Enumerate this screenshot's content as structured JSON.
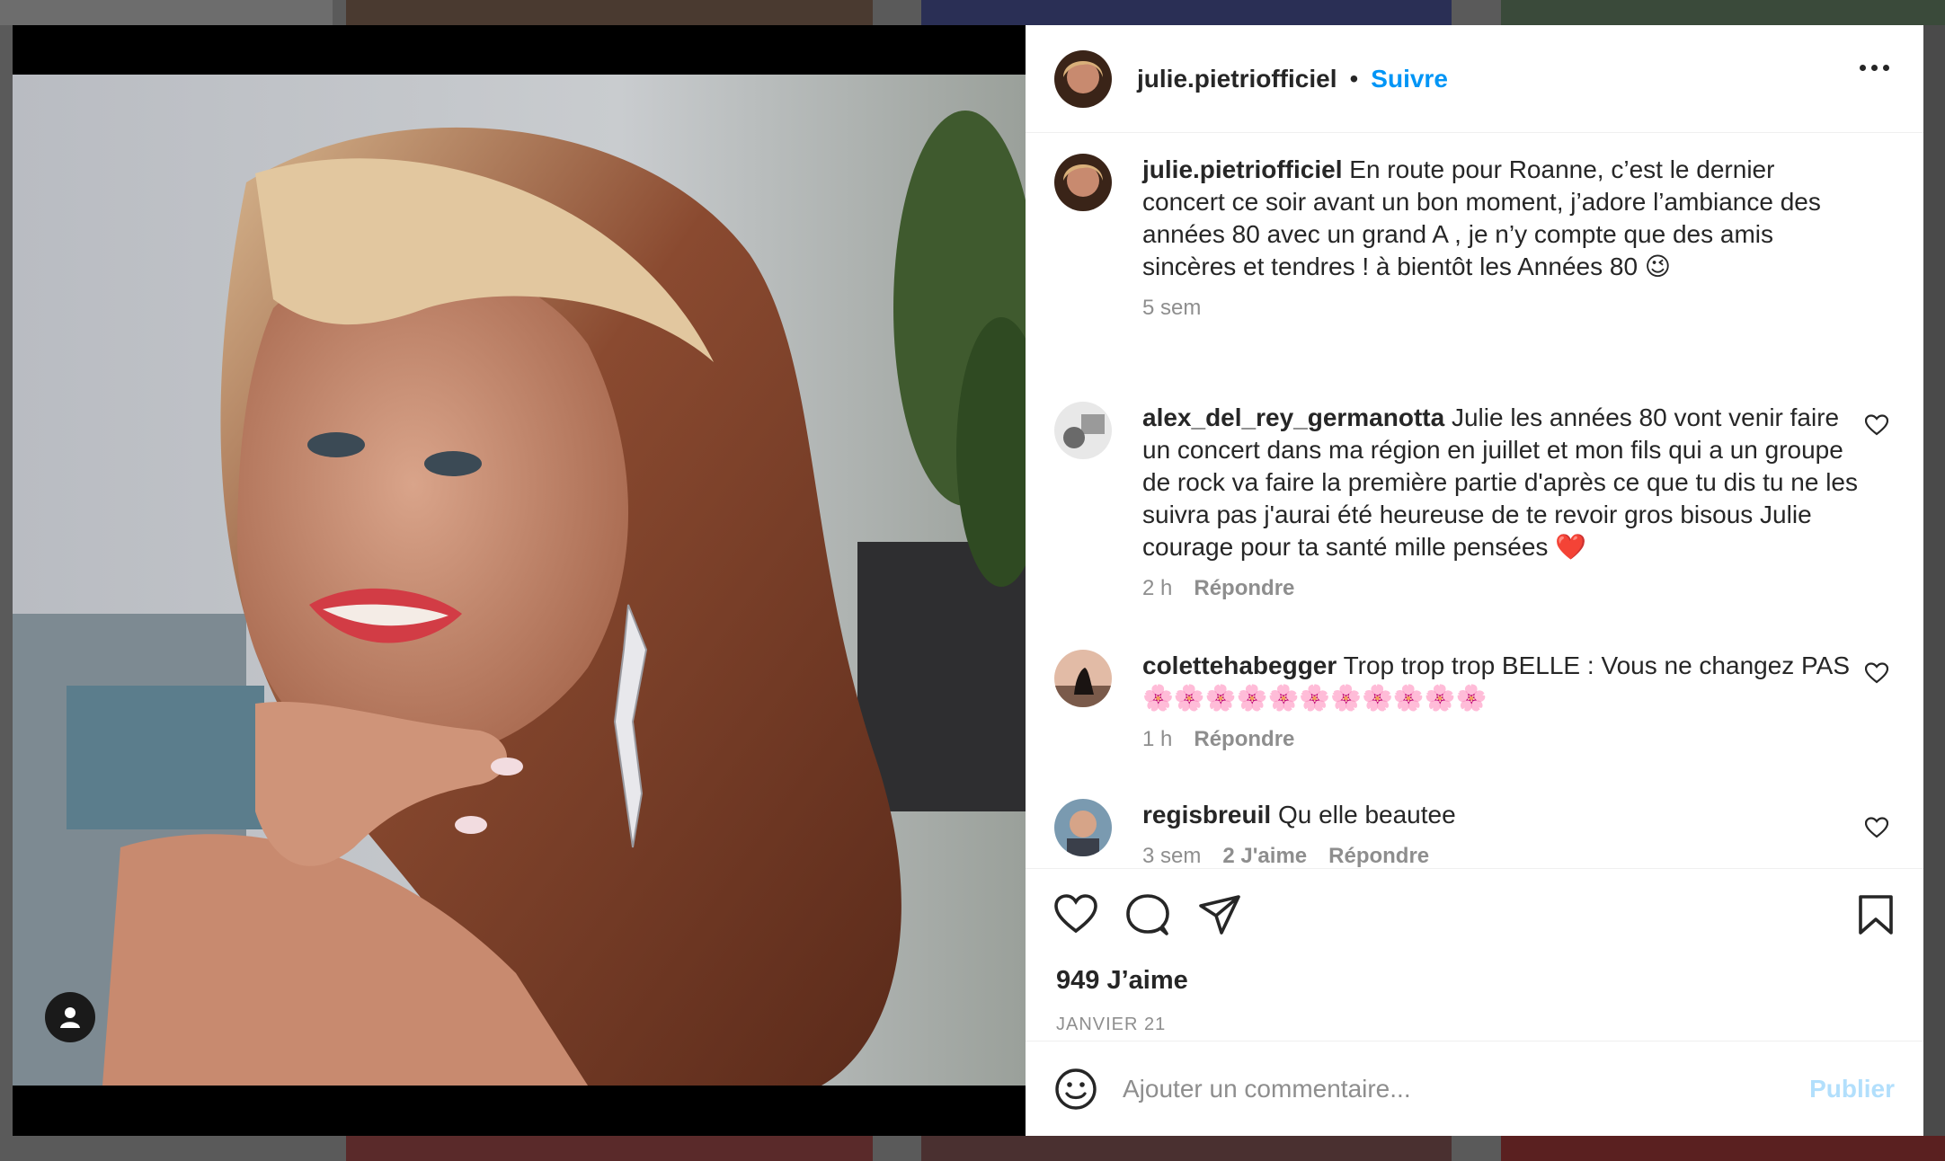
{
  "post": {
    "username": "julie.pietriofficiel",
    "separator": "•",
    "follow_label": "Suivre",
    "caption": "En route pour Roanne, c’est le dernier concert ce soir avant un bon moment, j’adore l’ambiance des années 80 avec un grand A , je n’y compte que des amis sincères et tendres ! à bientôt les Années 80 😉",
    "caption_time": "5 sem",
    "likes": "949 J’aime",
    "date": "JANVIER 21"
  },
  "comments": [
    {
      "username": "alex_del_rey_germanotta",
      "text": "Julie les années 80 vont venir faire un concert dans ma région en juillet et mon fils qui a un groupe de rock va faire la première partie d'après ce que tu dis tu ne les suivra pas j'aurai été heureuse de te revoir gros bisous Julie courage pour ta santé mille pensées ❤️",
      "time": "2 h",
      "reply": "Répondre"
    },
    {
      "username": "colettehabegger",
      "text": "Trop trop trop BELLE : Vous ne changez PAS 🌸🌸🌸🌸🌸🌸🌸🌸🌸🌸🌸",
      "time": "1 h",
      "reply": "Répondre"
    },
    {
      "username": "regisbreuil",
      "text": "Qu elle beautee",
      "time": "3 sem",
      "likes": "2 J'aime",
      "reply": "Répondre"
    }
  ],
  "composer": {
    "placeholder": "Ajouter un commentaire...",
    "publish_label": "Publier"
  },
  "colors": {
    "accent": "#0095f6",
    "publish_disabled": "#b2dffc",
    "text": "#262626",
    "muted": "#8e8e8e"
  }
}
